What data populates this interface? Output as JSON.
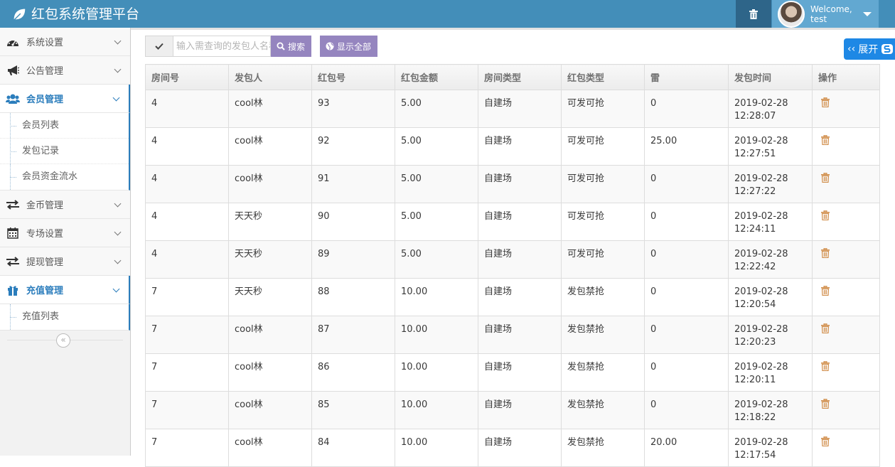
{
  "app": {
    "title": "红包系统管理平台"
  },
  "user": {
    "welcome": "Welcome,",
    "name": "test"
  },
  "sidebar": {
    "items": [
      {
        "label": "系统设置",
        "icon": "dashboard-icon"
      },
      {
        "label": "公告管理",
        "icon": "bullhorn-icon"
      },
      {
        "label": "会员管理",
        "icon": "users-icon",
        "active": true,
        "children": [
          "会员列表",
          "发包记录",
          "会员资金流水"
        ]
      },
      {
        "label": "金币管理",
        "icon": "exchange-icon"
      },
      {
        "label": "专场设置",
        "icon": "calendar-icon"
      },
      {
        "label": "提现管理",
        "icon": "exchange-icon"
      },
      {
        "label": "充值管理",
        "icon": "gift-icon",
        "active": true,
        "children": [
          "充值列表"
        ]
      }
    ],
    "collapse_glyph": "«"
  },
  "search": {
    "placeholder": "输入需查询的发包人名称",
    "search_label": "搜索",
    "show_all_label": "显示全部"
  },
  "expand": {
    "label": "展开"
  },
  "table": {
    "headers": [
      "房间号",
      "发包人",
      "红包号",
      "红包金额",
      "房间类型",
      "红包类型",
      "雷",
      "发包时间",
      "操作"
    ],
    "rows": [
      [
        "4",
        "cool林",
        "93",
        "5.00",
        "自建场",
        "可发可抢",
        "0",
        "2019-02-28",
        "12:28:07"
      ],
      [
        "4",
        "cool林",
        "92",
        "5.00",
        "自建场",
        "可发可抢",
        "25.00",
        "2019-02-28",
        "12:27:51"
      ],
      [
        "4",
        "cool林",
        "91",
        "5.00",
        "自建场",
        "可发可抢",
        "0",
        "2019-02-28",
        "12:27:22"
      ],
      [
        "4",
        "天天秒",
        "90",
        "5.00",
        "自建场",
        "可发可抢",
        "0",
        "2019-02-28",
        "12:24:11"
      ],
      [
        "4",
        "天天秒",
        "89",
        "5.00",
        "自建场",
        "可发可抢",
        "0",
        "2019-02-28",
        "12:22:42"
      ],
      [
        "7",
        "天天秒",
        "88",
        "10.00",
        "自建场",
        "发包禁抢",
        "0",
        "2019-02-28",
        "12:20:54"
      ],
      [
        "7",
        "cool林",
        "87",
        "10.00",
        "自建场",
        "发包禁抢",
        "0",
        "2019-02-28",
        "12:20:23"
      ],
      [
        "7",
        "cool林",
        "86",
        "10.00",
        "自建场",
        "发包禁抢",
        "0",
        "2019-02-28",
        "12:20:11"
      ],
      [
        "7",
        "cool林",
        "85",
        "10.00",
        "自建场",
        "发包禁抢",
        "0",
        "2019-02-28",
        "12:18:22"
      ],
      [
        "7",
        "cool林",
        "84",
        "10.00",
        "自建场",
        "发包禁抢",
        "20.00",
        "2019-02-28",
        "12:17:54"
      ]
    ]
  },
  "colors": {
    "navbar": "#438eb9",
    "accent": "#2b7dbc",
    "button": "#9585bf",
    "trash": "#d18e4b"
  }
}
